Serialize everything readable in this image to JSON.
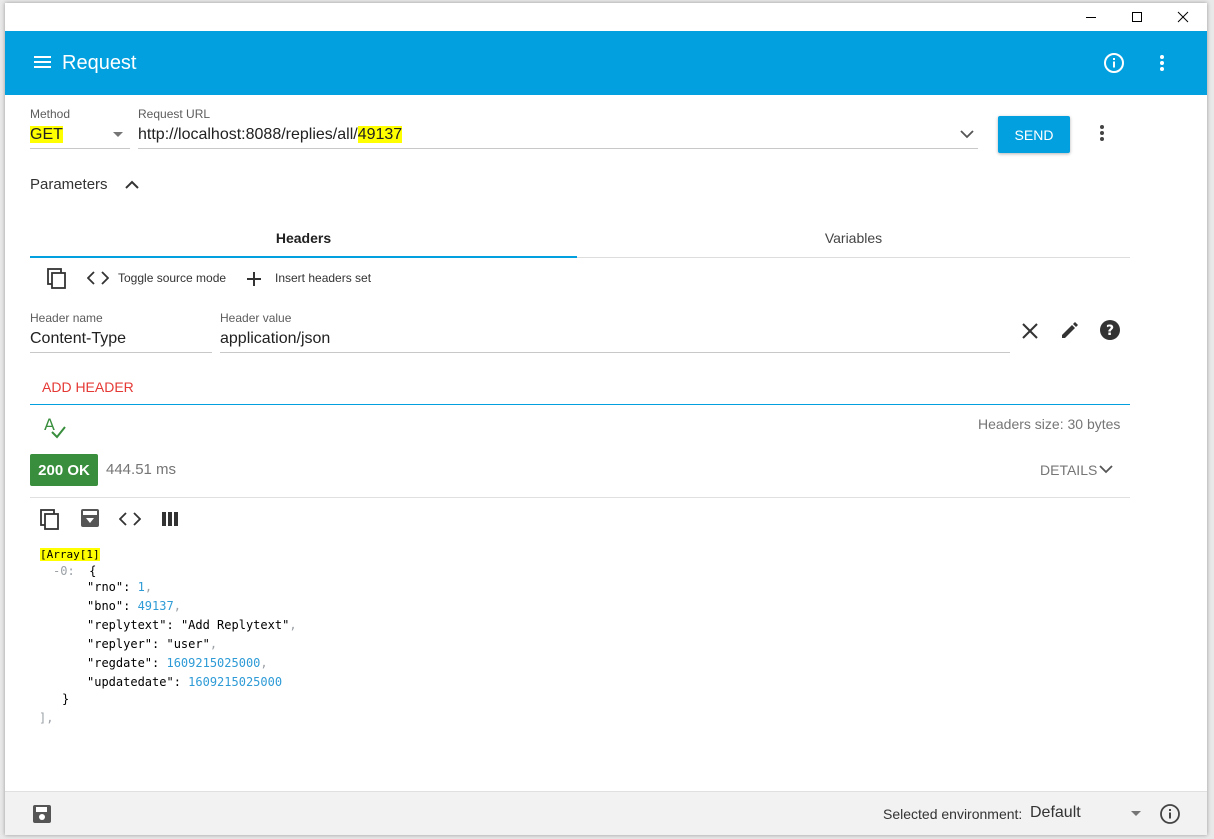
{
  "app": {
    "title": "Request"
  },
  "request": {
    "method_label": "Method",
    "method": "GET",
    "url_label": "Request URL",
    "url_prefix": "http://localhost:8088/replies/all/",
    "url_id": "49137",
    "send_label": "SEND"
  },
  "parameters": {
    "label": "Parameters"
  },
  "tabs": [
    {
      "label": "Headers",
      "active": true
    },
    {
      "label": "Variables",
      "active": false
    }
  ],
  "header_toolbar": {
    "toggle_label": "Toggle source mode",
    "insert_label": "Insert headers set"
  },
  "header_row": {
    "name_label": "Header name",
    "name": "Content-Type",
    "value_label": "Header value",
    "value": "application/json"
  },
  "add_header_label": "ADD HEADER",
  "headers_size": "Headers size: 30 bytes",
  "response": {
    "status": "200 OK",
    "time": "444.51 ms",
    "details_label": "DETAILS"
  },
  "json_view": {
    "array_label": "[Array[1]",
    "index_line": "-0:",
    "open_brace": "{",
    "fields": [
      {
        "key": "\"rno\"",
        "value": "1",
        "type": "number",
        "comma": ","
      },
      {
        "key": "\"bno\"",
        "value": "49137",
        "type": "number",
        "comma": ","
      },
      {
        "key": "\"replytext\"",
        "value": "\"Add Replytext\"",
        "type": "string",
        "comma": ","
      },
      {
        "key": "\"replyer\"",
        "value": "\"user\"",
        "type": "string",
        "comma": ","
      },
      {
        "key": "\"regdate\"",
        "value": "1609215025000",
        "type": "number",
        "comma": ","
      },
      {
        "key": "\"updatedate\"",
        "value": "1609215025000",
        "type": "number",
        "comma": ""
      }
    ],
    "close_brace": "}",
    "close_array": "],"
  },
  "footer": {
    "env_label": "Selected environment:",
    "env_value": "Default"
  },
  "colors": {
    "accent": "#03a0e0",
    "status_ok": "#388e3c",
    "add_header": "#e53935",
    "highlight": "#ffff00"
  }
}
